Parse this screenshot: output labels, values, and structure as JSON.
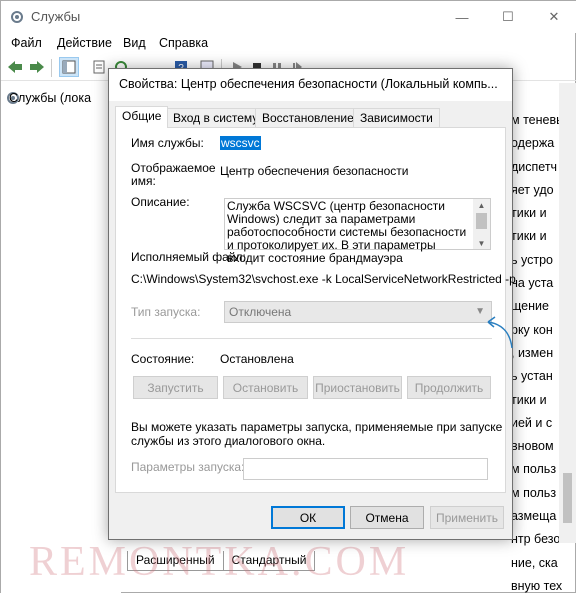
{
  "app": {
    "title": "Службы",
    "window_buttons": {
      "minimize": "—",
      "maximize": "☐",
      "close": "✕"
    }
  },
  "menu": [
    "Файл",
    "Действие",
    "Вид",
    "Справка"
  ],
  "tree": {
    "item_label": "Службы (лока"
  },
  "description_pane_lines": [
    "м теневы",
    "одержа",
    "диспетч",
    "яет удо",
    "тики и",
    "тики и",
    "ь устро",
    "на уста",
    "щение",
    "рку кон",
    ", измен",
    "ь устан",
    "тики и",
    "ией и с",
    "вновом",
    "м польз",
    "м польз",
    "азмеща",
    "нтр безо",
    "ние, ска",
    "вную тех"
  ],
  "bottom_tabs": [
    "Расширенный",
    "Стандартный"
  ],
  "watermark": "REMONTKA.COM",
  "dialog": {
    "title": "Свойства: Центр обеспечения безопасности (Локальный компь...",
    "tabs": [
      "Общие",
      "Вход в систему",
      "Восстановление",
      "Зависимости"
    ],
    "service_name_label": "Имя службы:",
    "service_name_value": "wscsvc",
    "display_name_label_1": "Отображаемое",
    "display_name_label_2": "имя:",
    "display_name_value": "Центр обеспечения безопасности",
    "description_label": "Описание:",
    "description_text": "Служба WSCSVC (центр безопасности Windows) следит за параметрами работоспособности системы безопасности и протоколирует их. В эти параметры входит состояние брандмауэра",
    "exe_label": "Исполняемый файл:",
    "exe_path": "C:\\Windows\\System32\\svchost.exe -k LocalServiceNetworkRestricted -p",
    "startup_type_label": "Тип запуска:",
    "startup_type_value": "Отключена",
    "status_label": "Состояние:",
    "status_value": "Остановлена",
    "btn_start": "Запустить",
    "btn_stop": "Остановить",
    "btn_pause": "Приостановить",
    "btn_resume": "Продолжить",
    "hint_1": "Вы можете указать параметры запуска, применяемые при запуске",
    "hint_2": "службы из этого диалогового окна.",
    "start_params_label": "Параметры запуска:",
    "start_params_value": "",
    "btn_ok": "ОК",
    "btn_cancel": "Отмена",
    "btn_apply": "Применить"
  },
  "colors": {
    "accent": "#0078d7",
    "hint_arrow": "#2a7fc0"
  }
}
